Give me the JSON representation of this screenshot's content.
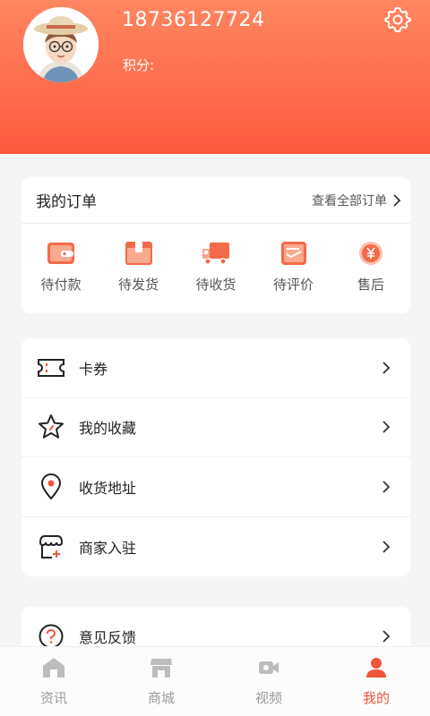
{
  "profile": {
    "phone": "18736127724",
    "points_label": "积分:"
  },
  "orders": {
    "title": "我的订单",
    "view_all": "查看全部订单",
    "items": [
      {
        "label": "待付款",
        "icon": "wallet-icon"
      },
      {
        "label": "待发货",
        "icon": "package-icon"
      },
      {
        "label": "待收货",
        "icon": "truck-icon"
      },
      {
        "label": "待评价",
        "icon": "review-icon"
      },
      {
        "label": "售后",
        "icon": "refund-icon"
      }
    ]
  },
  "menu": {
    "items": [
      {
        "label": "卡券",
        "icon": "ticket-icon"
      },
      {
        "label": "我的收藏",
        "icon": "star-icon"
      },
      {
        "label": "收货地址",
        "icon": "location-pin-icon"
      },
      {
        "label": "商家入驻",
        "icon": "store-plus-icon"
      },
      {
        "label": "意见反馈",
        "icon": "help-circle-icon"
      }
    ]
  },
  "tabbar": {
    "items": [
      {
        "label": "资讯",
        "icon": "home-icon"
      },
      {
        "label": "商城",
        "icon": "shop-icon"
      },
      {
        "label": "视频",
        "icon": "video-icon"
      },
      {
        "label": "我的",
        "icon": "user-icon"
      }
    ],
    "active_index": 3
  },
  "colors": {
    "accent": "#f2553b",
    "header_top": "#ff8660",
    "header_bottom": "#fb5a3e",
    "inactive": "#c4c4c4"
  }
}
